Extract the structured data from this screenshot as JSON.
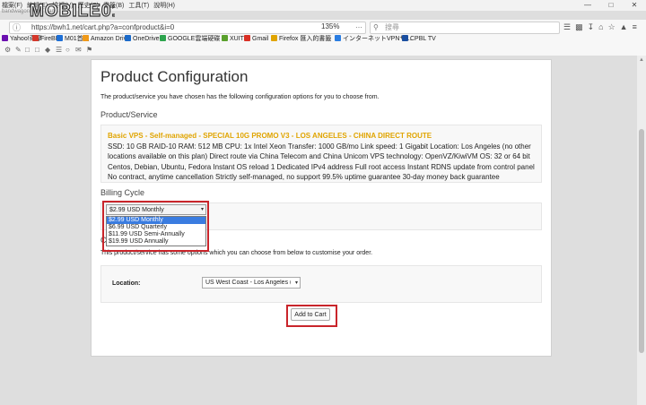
{
  "browser": {
    "menu": [
      "檔案(F)",
      "編輯(E)",
      "檢視(V)",
      "歷史(S)",
      "書籤(B)",
      "工具(T)",
      "說明(H)"
    ],
    "tab_fragment": "bandwagonHOST Tan",
    "logo_text": "MOBILE01",
    "url": "https://bwh1.net/cart.php?a=confproduct&i=0",
    "zoom": "135%",
    "search_placeholder": "搜尋"
  },
  "bookmarks": [
    {
      "label": "Yahoo!奇摩",
      "color": "#6b0fb0"
    },
    {
      "label": "FireBIS",
      "color": "#d4382b"
    },
    {
      "label": "M01首頁",
      "color": "#1e6fd6"
    },
    {
      "label": "Amazon Drive",
      "color": "#f09a1a"
    },
    {
      "label": "OneDrive",
      "color": "#1b6ac9"
    },
    {
      "label": "GOOGLE雲端硬碟",
      "color": "#2da44e"
    },
    {
      "label": "XUITE",
      "color": "#5aa02c"
    },
    {
      "label": "Gmail",
      "color": "#d93025"
    },
    {
      "label": "Firefox 匯入的書籤",
      "color": "#e0a400"
    },
    {
      "label": "インターネットVPNサ...",
      "color": "#2a7de1"
    },
    {
      "label": "CPBL TV",
      "color": "#1a4fa0"
    }
  ],
  "page": {
    "title": "Product Configuration",
    "intro": "The product/service you have chosen has the following configuration options for you to choose from.",
    "product_heading": "Product/Service",
    "product_name": "Basic VPS - Self-managed - SPECIAL 10G PROMO V3 - LOS ANGELES - CHINA DIRECT ROUTE",
    "product_desc": "SSD: 10 GB RAID-10 RAM: 512 MB CPU: 1x Intel Xeon Transfer: 1000 GB/mo Link speed: 1 Gigabit Location: Los Angeles (no other locations available on this plan) Direct route via China Telecom and China Unicom VPS technology: OpenVZ/KiwiVM OS: 32 or 64 bit Centos, Debian, Ubuntu, Fedora Instant OS reload 1 Dedicated IPv4 address Full root access Instant RDNS update from control panel No contract, anytime cancellation Strictly self-managed, no support 99.5% uptime guarantee 30-day money back guarantee",
    "billing_heading": "Billing Cycle",
    "billing_selected": "$2.99 USD Monthly",
    "billing_options": [
      "$2.99 USD Monthly",
      "$6.99 USD Quarterly",
      "$11.99 USD Semi-Annually",
      "$19.99 USD Annually"
    ],
    "config_heading_fragment": "C",
    "config_text": "This product/service has some options which you can choose from below to customise your order.",
    "location_label": "Location:",
    "location_value": "US West Coast - Los Angeles (US",
    "add_to_cart": "Add to Cart"
  },
  "colors": {
    "accent_highlight": "#c9252b",
    "product_name": "#e0a400",
    "selected_option": "#3a7ce0"
  }
}
